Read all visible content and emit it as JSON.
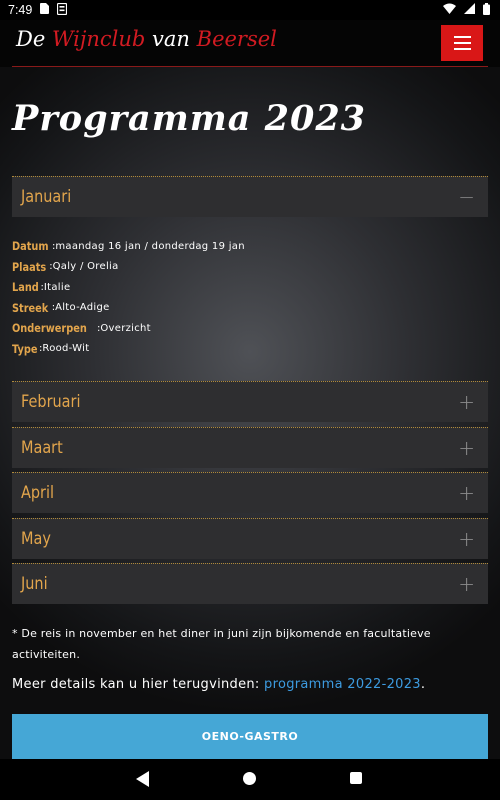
{
  "status_bar": {
    "time": "7:49"
  },
  "header": {
    "logo": {
      "part1": "De ",
      "part2": "Wijnclub",
      "part3": " van ",
      "part4": "Beersel"
    }
  },
  "page": {
    "title": "Programma 2023"
  },
  "accordion": {
    "items": [
      {
        "label": "Januari",
        "expanded_icon": "−"
      },
      {
        "label": "Februari",
        "collapsed_icon": "+"
      },
      {
        "label": "Maart",
        "collapsed_icon": "+"
      },
      {
        "label": "April",
        "collapsed_icon": "+"
      },
      {
        "label": "May",
        "collapsed_icon": "+"
      },
      {
        "label": "Juni",
        "collapsed_icon": "+"
      }
    ]
  },
  "details": {
    "datum_key": "Datum",
    "datum_val": "maandag 16 jan / donderdag 19 jan",
    "plaats_key": "Plaats",
    "plaats_val": "Qaly / Orelia",
    "land_key": "Land",
    "land_val": "Italie",
    "streek_key": "Streek",
    "streek_val": "Alto-Adige",
    "onderwerpen_key": "Onderwerpen",
    "onderwerpen_val": "Overzicht",
    "type_key": "Type",
    "type_val": "Rood-Wit",
    "separator": " : "
  },
  "footnote": "* De reis in november en het diner in juni zijn bijkomende en facultatieve activiteiten.",
  "more_details": {
    "prefix": "Meer details kan u hier terugvinden: ",
    "link_text": "programma 2022-2023",
    "suffix": "."
  },
  "cta": {
    "label": "OENO-GASTRO"
  },
  "colors": {
    "accent_gold": "#e2a54c",
    "brand_red": "#d91717",
    "link_blue": "#3d9be0",
    "button_blue": "#45a7d6"
  }
}
